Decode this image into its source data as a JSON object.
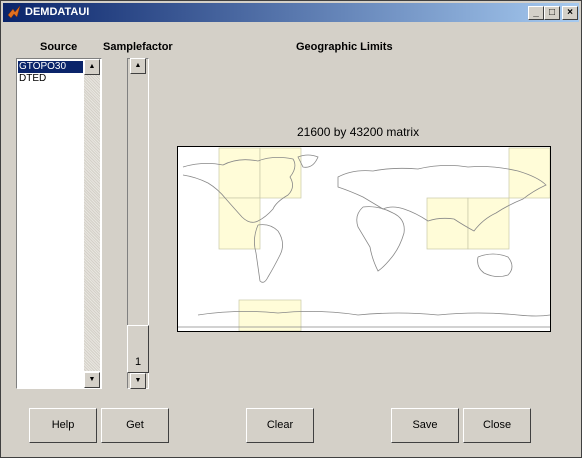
{
  "window": {
    "title": "DEMDATAUI"
  },
  "titlebar_buttons": {
    "minimize": "_",
    "maximize": "□",
    "close": "×"
  },
  "labels": {
    "source": "Source",
    "samplefactor": "Samplefactor",
    "geographic_limits": "Geographic Limits"
  },
  "source_list": {
    "items": [
      "GTOPO30",
      "DTED"
    ],
    "selected": "GTOPO30"
  },
  "samplefactor": {
    "value": "1"
  },
  "map": {
    "title": "21600 by 43200 matrix"
  },
  "buttons": {
    "help": "Help",
    "get": "Get",
    "clear": "Clear",
    "save": "Save",
    "close": "Close"
  },
  "colors": {
    "tile_fill": "#fffcd8",
    "tile_edge": "#c8c8a8",
    "coast": "#888888",
    "selection": "#0a246a"
  }
}
